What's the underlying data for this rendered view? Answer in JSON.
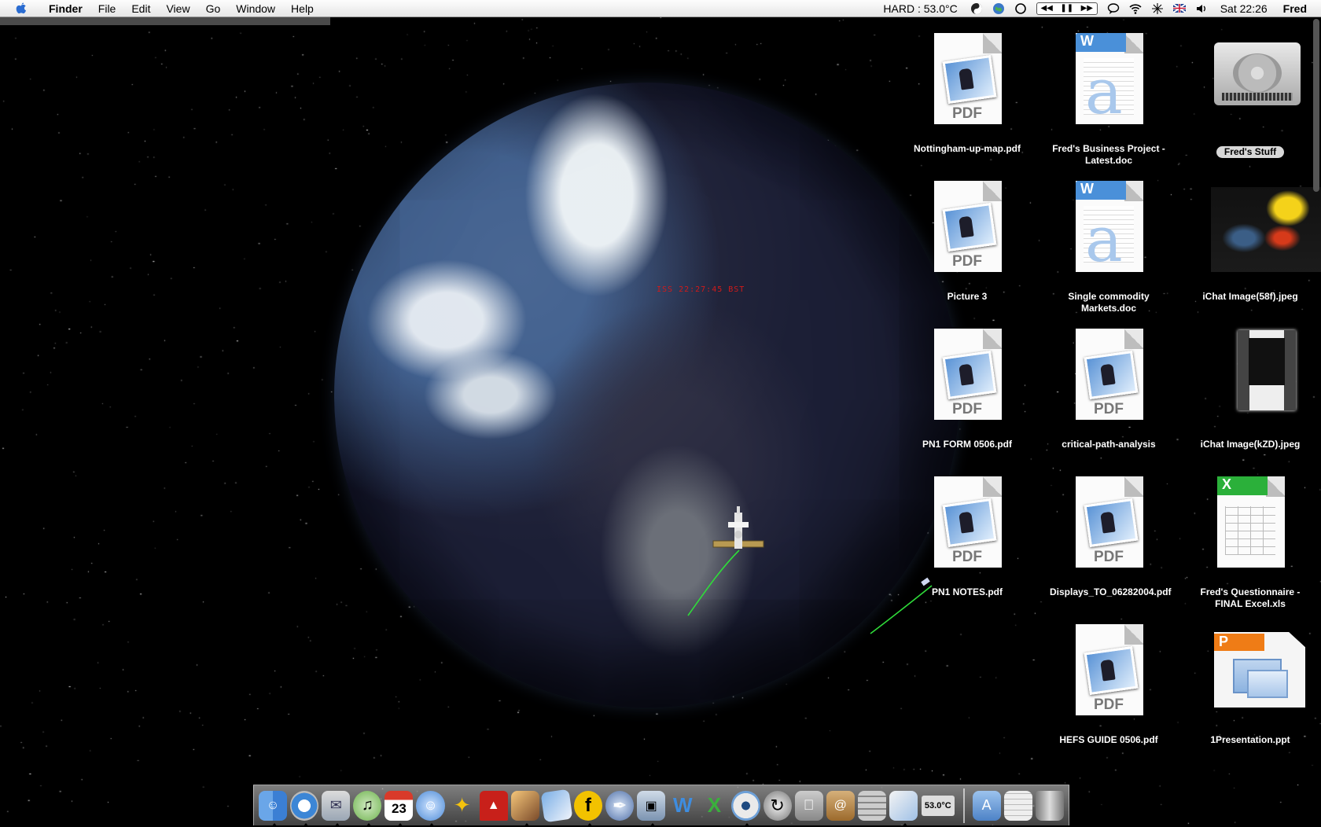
{
  "menubar": {
    "app_name": "Finder",
    "menus": [
      "File",
      "Edit",
      "View",
      "Go",
      "Window",
      "Help"
    ],
    "status_hard": "HARD :  53.0°C",
    "clock": "Sat 22:26",
    "user": "Fred"
  },
  "globe": {
    "clock_label": "ISS 22:27:45 BST"
  },
  "desktop_icons": [
    {
      "label": "Nottingham-up-map.pdf",
      "kind": "pdf"
    },
    {
      "label": "Fred's Business Project - Latest.doc",
      "kind": "doc"
    },
    {
      "label": "Fred's Stuff",
      "kind": "hdd"
    },
    {
      "label": "Picture 3",
      "kind": "pdf"
    },
    {
      "label": "Single commodity Markets.doc",
      "kind": "doc"
    },
    {
      "label": "iChat Image(58f).jpeg",
      "kind": "photo"
    },
    {
      "label": "PN1 FORM 0506.pdf",
      "kind": "pdf"
    },
    {
      "label": "critical-path-analysis",
      "kind": "pdf"
    },
    {
      "label": "iChat Image(kZD).jpeg",
      "kind": "photo2"
    },
    {
      "label": "PN1 NOTES.pdf",
      "kind": "pdf"
    },
    {
      "label": "Displays_TO_06282004.pdf",
      "kind": "pdf"
    },
    {
      "label": "Fred's Questionnaire -FINAL Excel.xls",
      "kind": "xls"
    },
    {
      "label": "HEFS GUIDE 0506.pdf",
      "kind": "pdf"
    },
    {
      "label": "1Presentation.ppt",
      "kind": "ppt"
    }
  ],
  "icon_text": {
    "pdf": "PDF",
    "word": "W",
    "excel": "X",
    "ppt": "P"
  },
  "dock": {
    "calendar_day": "23",
    "temp_widget": "53.0°C",
    "items": [
      "finder-icon",
      "safari-icon",
      "mail-icon",
      "itunes-icon",
      "ical-icon",
      "ichat-icon",
      "fire-icon",
      "iphoto-icon",
      "address-icon",
      "firefox-icon",
      "quill-icon",
      "preview-icon",
      "word-icon",
      "excel-icon",
      "lifesaver-icon",
      "sync-icon",
      "apple-icon",
      "address-book-icon",
      "calculator-icon",
      "pdf-viewer-icon",
      "temp-icon"
    ]
  }
}
